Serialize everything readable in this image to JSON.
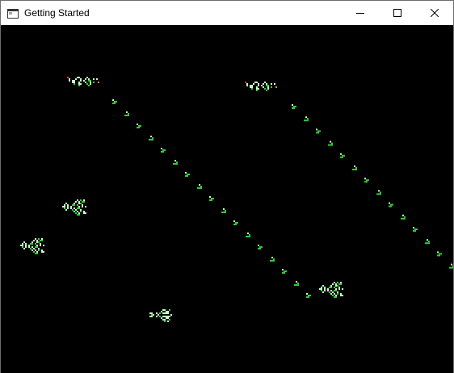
{
  "window": {
    "title": "Getting Started",
    "controls": {
      "minimize_icon": "minimize-icon",
      "maximize_icon": "maximize-icon",
      "close_icon": "close-icon"
    }
  },
  "colors": {
    "background": "#000000",
    "cell_light": "#c8ffc8",
    "cell_green": "#33cc33",
    "cell_bright": "#7dff7d",
    "cell_red": "#ff3333",
    "cell_orange": "#ff9900"
  },
  "simulation": {
    "type": "cellular-automaton",
    "patterns": [
      "glider-gun",
      "glider-gun",
      "puffer",
      "puffer",
      "puffer",
      "puffer",
      "glider-stream",
      "glider-stream"
    ]
  }
}
